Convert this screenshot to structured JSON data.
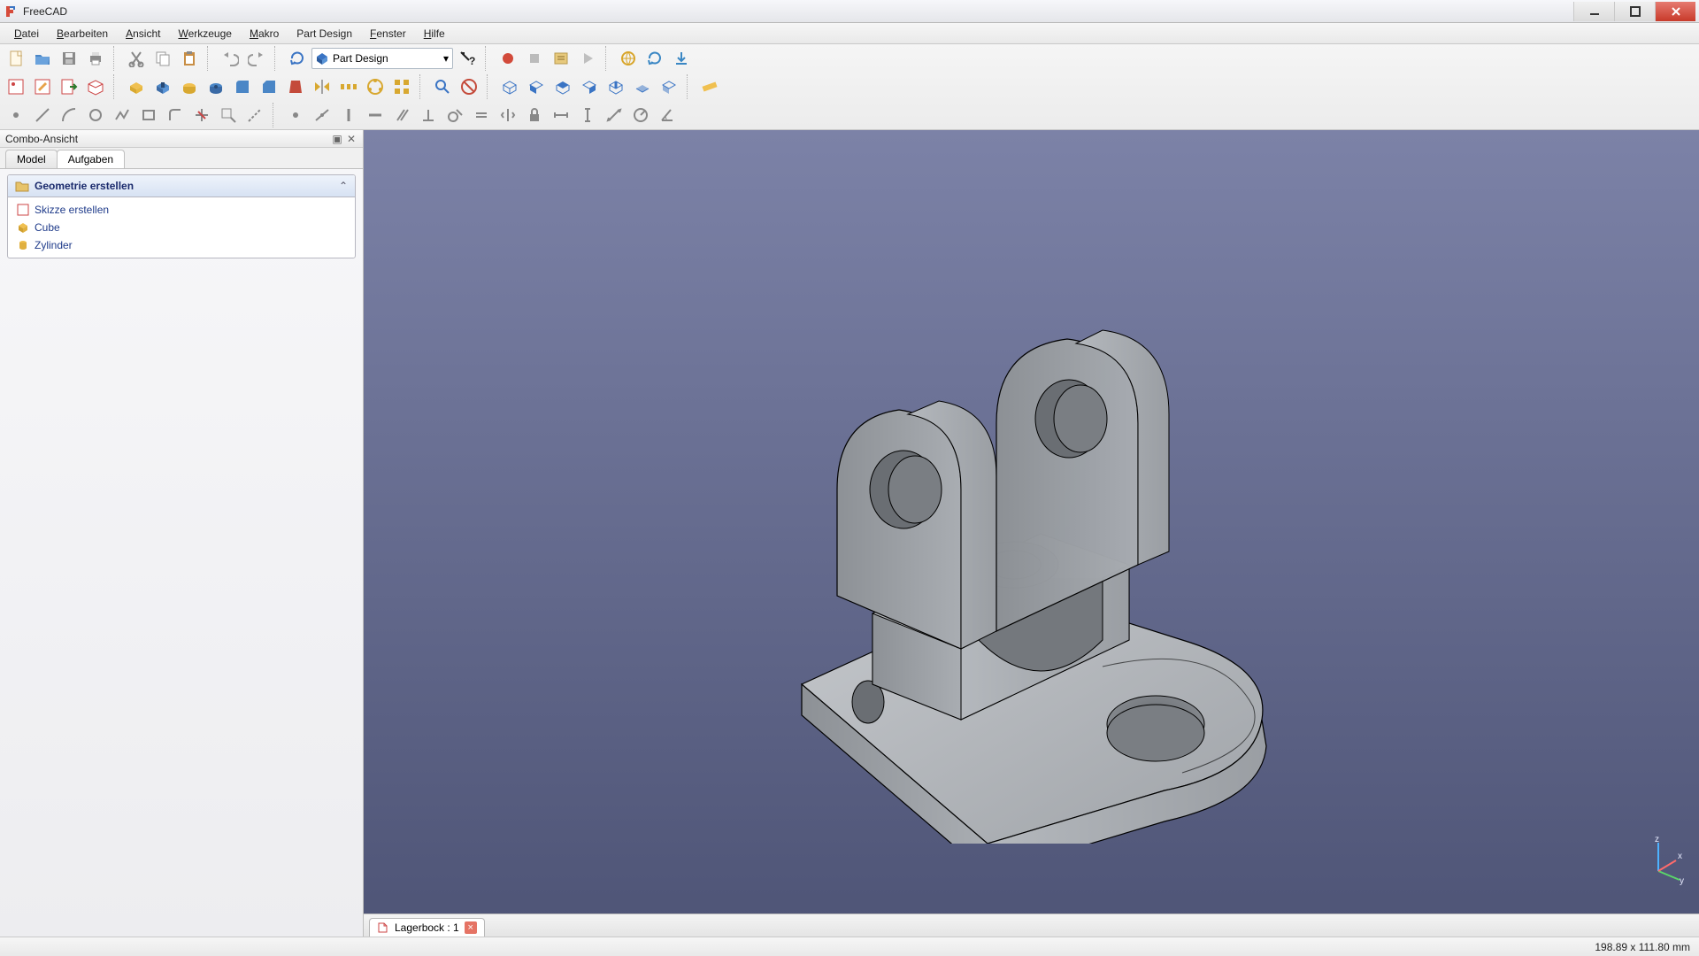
{
  "app": {
    "title": "FreeCAD"
  },
  "menus": {
    "file": {
      "label": "Datei",
      "mnemonic": "D"
    },
    "edit": {
      "label": "Bearbeiten",
      "mnemonic": "B"
    },
    "view": {
      "label": "Ansicht",
      "mnemonic": "A"
    },
    "tools": {
      "label": "Werkzeuge",
      "mnemonic": "W"
    },
    "macro": {
      "label": "Makro",
      "mnemonic": "M"
    },
    "part": {
      "label": "Part Design",
      "mnemonic": "P"
    },
    "window": {
      "label": "Fenster",
      "mnemonic": "F"
    },
    "help": {
      "label": "Hilfe",
      "mnemonic": "H"
    }
  },
  "workbench": {
    "selected": "Part Design"
  },
  "combo": {
    "panel_title": "Combo-Ansicht",
    "tabs": {
      "model": "Model",
      "tasks": "Aufgaben"
    },
    "group_title": "Geometrie erstellen",
    "items": {
      "sketch": "Skizze erstellen",
      "cube": "Cube",
      "cylinder": "Zylinder"
    }
  },
  "document": {
    "tab_label": "Lagerbock : 1"
  },
  "status": {
    "dimensions": "198.89 x 111.80 mm"
  },
  "axes": {
    "x": "x",
    "y": "y",
    "z": "z"
  }
}
